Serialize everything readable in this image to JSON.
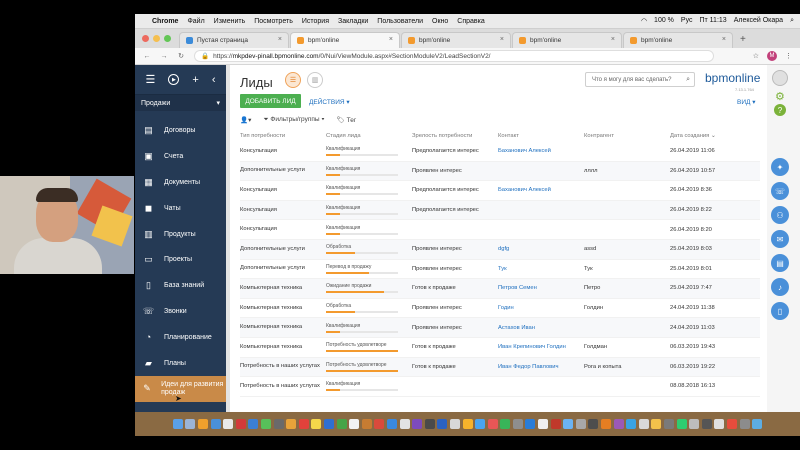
{
  "macbar": {
    "apple": "",
    "app": "Chrome",
    "menus": [
      "Файл",
      "Изменить",
      "Посмотреть",
      "История",
      "Закладки",
      "Пользователи",
      "Окно",
      "Справка"
    ],
    "battery": "100 %",
    "lang": "Рус",
    "clock": "Пт 11:13",
    "user": "Алексей Окара"
  },
  "tabs": [
    {
      "title": "Пустая страница",
      "active": false,
      "fav": "b"
    },
    {
      "title": "bpm'online",
      "active": true,
      "fav": "o"
    },
    {
      "title": "bpm'online",
      "active": false,
      "fav": "o"
    },
    {
      "title": "bpm'online",
      "active": false,
      "fav": "o"
    },
    {
      "title": "bpm'online",
      "active": false,
      "fav": "o"
    }
  ],
  "address": {
    "scheme": "https://",
    "host": "mkpdev-pinall.bpmonline.com",
    "path": "/0/Nui/ViewModule.aspx#SectionModuleV2/LeadSectionV2/",
    "profile_letter": "M"
  },
  "sidebar": {
    "workspace": "Продажи",
    "items": [
      {
        "label": "Договоры",
        "icon": "document-icon",
        "glyph": "▤"
      },
      {
        "label": "Счета",
        "icon": "invoice-icon",
        "glyph": "▣"
      },
      {
        "label": "Документы",
        "icon": "documents-icon",
        "glyph": "▦"
      },
      {
        "label": "Чаты",
        "icon": "chat-icon",
        "glyph": "◼"
      },
      {
        "label": "Продукты",
        "icon": "box-icon",
        "glyph": "▥"
      },
      {
        "label": "Проекты",
        "icon": "projects-icon",
        "glyph": "▭"
      },
      {
        "label": "База знаний",
        "icon": "book-icon",
        "glyph": "▯"
      },
      {
        "label": "Звонки",
        "icon": "phone-icon",
        "glyph": "☏"
      },
      {
        "label": "Планирование",
        "icon": "planning-icon",
        "glyph": "◔"
      },
      {
        "label": "Планы",
        "icon": "plans-icon",
        "glyph": "▰"
      },
      {
        "label": "Идеи для развития продаж",
        "icon": "idea-icon",
        "glyph": "✎",
        "active": true
      }
    ]
  },
  "main": {
    "title": "Лиды",
    "search_placeholder": "Что я могу для вас сделать?",
    "brand": "bpmonline",
    "version": "7.13.1.764",
    "add_button": "ДОБАВИТЬ ЛИД",
    "actions": "ДЕЙСТВИЯ ▾",
    "view": "ВИД ▾",
    "filters": "Фильтры/группы ▾",
    "tag": "Тег"
  },
  "table": {
    "headers": [
      "Тип потребности",
      "Стадия лида",
      "Зрелость потребности",
      "Контакт",
      "Контрагент",
      "Дата создания ⌄"
    ],
    "rows": [
      {
        "need": "Консультация",
        "stage": "Квалификация",
        "progress": 0.2,
        "maturity": "Предполагается интерес",
        "contact": "Баханович Алексей",
        "account": "",
        "date": "26.04.2019 11:06"
      },
      {
        "need": "Дополнительные услуги",
        "stage": "Квалификация",
        "progress": 0.2,
        "maturity": "Проявлен интерес",
        "contact": "",
        "account": "лллл",
        "date": "26.04.2019 10:57"
      },
      {
        "need": "Консультация",
        "stage": "Квалификация",
        "progress": 0.2,
        "maturity": "Предполагается интерес",
        "contact": "Баханович Алексей",
        "account": "",
        "date": "26.04.2019 8:36"
      },
      {
        "need": "Консультация",
        "stage": "Квалификация",
        "progress": 0.2,
        "maturity": "Предполагается интерес",
        "contact": "",
        "account": "",
        "date": "26.04.2019 8:22"
      },
      {
        "need": "Консультация",
        "stage": "Квалификация",
        "progress": 0.2,
        "maturity": "",
        "contact": "",
        "account": "",
        "date": "26.04.2019 8:20"
      },
      {
        "need": "Дополнительные услуги",
        "stage": "Обработка",
        "progress": 0.4,
        "maturity": "Проявлен интерес",
        "contact": "dgfg",
        "account": "assd",
        "date": "25.04.2019 8:03"
      },
      {
        "need": "Дополнительные услуги",
        "stage": "Перевод в продажу",
        "progress": 0.6,
        "maturity": "Проявлен интерес",
        "contact": "Тук",
        "account": "Тук",
        "date": "25.04.2019 8:01"
      },
      {
        "need": "Компьютерная техника",
        "stage": "Ожидание продажи",
        "progress": 0.8,
        "maturity": "Готов к продаже",
        "contact": "Петров Семен",
        "account": "Петро",
        "date": "25.04.2019 7:47"
      },
      {
        "need": "Компьютерная техника",
        "stage": "Обработка",
        "progress": 0.4,
        "maturity": "Проявлен интерес",
        "contact": "Годин",
        "account": "Голдин",
        "date": "24.04.2019 11:38"
      },
      {
        "need": "Компьютерная техника",
        "stage": "Квалификация",
        "progress": 0.2,
        "maturity": "Проявлен интерес",
        "contact": "Астахов Иван",
        "account": "",
        "date": "24.04.2019 11:03"
      },
      {
        "need": "Компьютерная техника",
        "stage": "Потребность удовлетворе",
        "progress": 1.0,
        "maturity": "Готов к продаже",
        "contact": "Иван Крепинович Голдин",
        "account": "Голдман",
        "date": "06.03.2019 19:43"
      },
      {
        "need": "Потребность в наших услугах",
        "stage": "Потребность удовлетворе",
        "progress": 1.0,
        "maturity": "Готов к продаже",
        "contact": "Иван Федор Павлович",
        "account": "Рога и копыта",
        "date": "06.03.2019 19:22"
      },
      {
        "need": "Потребность в наших услугах",
        "stage": "Квалификация",
        "progress": 0.2,
        "maturity": "",
        "contact": "",
        "account": "",
        "date": "08.08.2018 16:13"
      }
    ]
  },
  "colors": {
    "sidebar": "#253a55",
    "active": "#c98a48",
    "accent": "#f39a2e",
    "link": "#1e6fbf",
    "add": "#4caf50"
  },
  "dock_colors": [
    "#5aa0e8",
    "#9bb4d6",
    "#f0a02c",
    "#4a90d9",
    "#e9e9e9",
    "#d23a3a",
    "#3b7fd4",
    "#58c05a",
    "#6a6a6a",
    "#e8a33a",
    "#e2423b",
    "#f5d74a",
    "#2f6fd1",
    "#47a447",
    "#f2f2f2",
    "#c77c32",
    "#da4a3c",
    "#3a89de",
    "#e3e3e3",
    "#7d4bbd",
    "#4a4a4a",
    "#2b62c2",
    "#d8d8d8",
    "#f7b32b",
    "#4aa5f0",
    "#e85656",
    "#38b559",
    "#8e8e8e",
    "#2a7dd8",
    "#f0f0f0",
    "#c0392b",
    "#6bb3f2",
    "#a8a8a8",
    "#4d4d4d",
    "#e67e22",
    "#9b59b6",
    "#3aa3e3",
    "#d9d9d9",
    "#f3c14b",
    "#7a7a7a",
    "#2ecc71",
    "#bdbdbd",
    "#555555",
    "#e0e0e0",
    "#e74c3c",
    "#8c8c8c",
    "#5dade2"
  ]
}
